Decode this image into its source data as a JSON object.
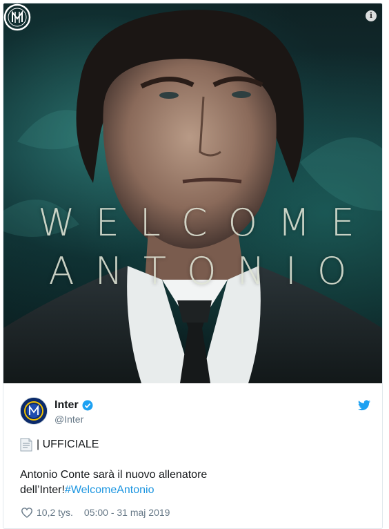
{
  "hero": {
    "title_line1": "WELCOME",
    "title_line2": "ANTONIO",
    "info_label": "i"
  },
  "tweet": {
    "display_name": "Inter",
    "handle": "@Inter",
    "text_line1": "| UFFICIALE",
    "text_line2_a": "Antonio Conte sarà il nuovo allenatore",
    "text_line2_b": "dell’Inter!",
    "hashtag": "#WelcomeAntonio",
    "likes": "10,2 tys.",
    "timestamp": "05:00 - 31 maj 2019"
  },
  "icons": {
    "info": "info-icon",
    "logo": "inter-logo-icon",
    "verified": "verified-badge-icon",
    "bird": "twitter-bird-icon",
    "document": "document-emoji-icon",
    "heart": "heart-icon"
  },
  "colors": {
    "link": "#1b95e0",
    "verified": "#1da1f2",
    "secondary_text": "#657786",
    "inter_blue": "#0b2a6b"
  }
}
